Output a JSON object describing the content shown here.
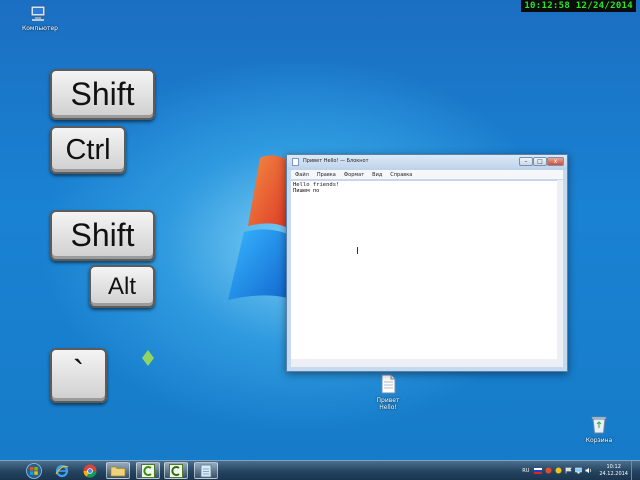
{
  "overlay_clock": "10:12:58  12/24/2014",
  "desktop": {
    "icons": [
      {
        "label": "Компьютер",
        "icon": "computer-icon"
      },
      {
        "label": "Привет Hello!",
        "icon": "text-file-icon"
      },
      {
        "label": "Корзина",
        "icon": "recycle-bin-icon"
      }
    ]
  },
  "keys": {
    "shift1": "Shift",
    "ctrl": "Ctrl",
    "shift2": "Shift",
    "alt": "Alt",
    "backtick": "`"
  },
  "notepad": {
    "title": "Привет Hello! — Блокнот",
    "menu": [
      "Файл",
      "Правка",
      "Формат",
      "Вид",
      "Справка"
    ],
    "content": "Hello friends!\nПишем по",
    "controls": {
      "minimize": "–",
      "maximize": "□",
      "close": "x"
    }
  },
  "taskbar": {
    "buttons": [
      {
        "name": "start-button",
        "icon": "windows-orb-icon"
      },
      {
        "name": "ie-button",
        "icon": "internet-explorer-icon"
      },
      {
        "name": "chrome-button",
        "icon": "chrome-icon"
      },
      {
        "name": "explorer-button",
        "icon": "folder-icon"
      },
      {
        "name": "camtasia-button-1",
        "icon": "camtasia-icon"
      },
      {
        "name": "camtasia-button-2",
        "icon": "camtasia-icon"
      },
      {
        "name": "notepad-button",
        "icon": "notepad-icon"
      }
    ],
    "language": "RU",
    "time": "10:12",
    "date": "24.12.2014"
  },
  "colors": {
    "desktop_blue": "#1a82d3",
    "overlay_clock_text": "#26e826",
    "taskbar": "#24445f"
  }
}
